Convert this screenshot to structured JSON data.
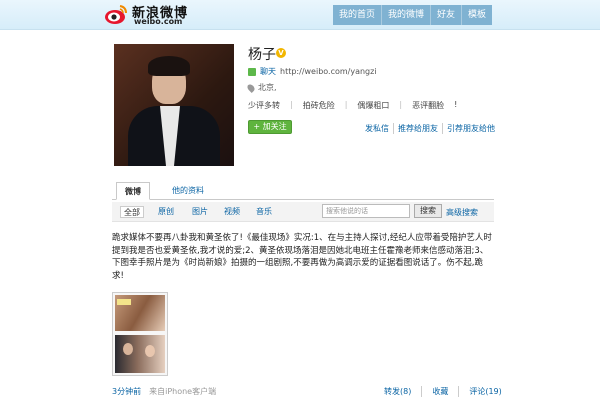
{
  "header": {
    "logo_cn": "新浪微博",
    "logo_en": "weibo.com",
    "nav": [
      "我的首页",
      "我的微博",
      "好友",
      "模板"
    ]
  },
  "profile": {
    "name": "杨子",
    "verified_badge": "V",
    "chat_label": "聊天",
    "url": "http://weibo.com/yangzi",
    "location": "北京,",
    "tags": [
      "少评多转",
      "拍砖危险",
      "偶爆粗口",
      "恶评翻脸"
    ],
    "tag_trailing": "!",
    "follow_button": "+ 加关注",
    "links": [
      "发私信",
      "推荐给朋友",
      "引荐朋友给他"
    ]
  },
  "tabs": [
    "微博",
    "他的资料"
  ],
  "filters": [
    "全部",
    "原创",
    "图片",
    "视频",
    "音乐"
  ],
  "search": {
    "placeholder": "搜索他说的话",
    "button": "搜索",
    "advanced": "高级搜索"
  },
  "post": {
    "text": "跪求媒体不要再八卦我和黄圣依了!《最佳现场》实况:1、在与主持人探讨,经纪人应带着受陪护艺人时提到我是否也爱黄圣依,我才说的爱;2、黄圣依现场落泪是因她北电班主任霍豫老师来信感动落泪;3、下图幸手照片是为《时尚新娘》拍摄的一组剧照,不要再做为高调示爱的证据看图说话了。伤不起,跪求!",
    "time": "3分钟前",
    "source": "来自iPhone客户端",
    "actions": [
      "转发(8)",
      "收藏",
      "评论(19)"
    ]
  },
  "colors": {
    "nav_bg": "#7fb2d2",
    "link": "#0a64a4",
    "follow_green": "#5fb43e",
    "verified": "#f2b600"
  }
}
